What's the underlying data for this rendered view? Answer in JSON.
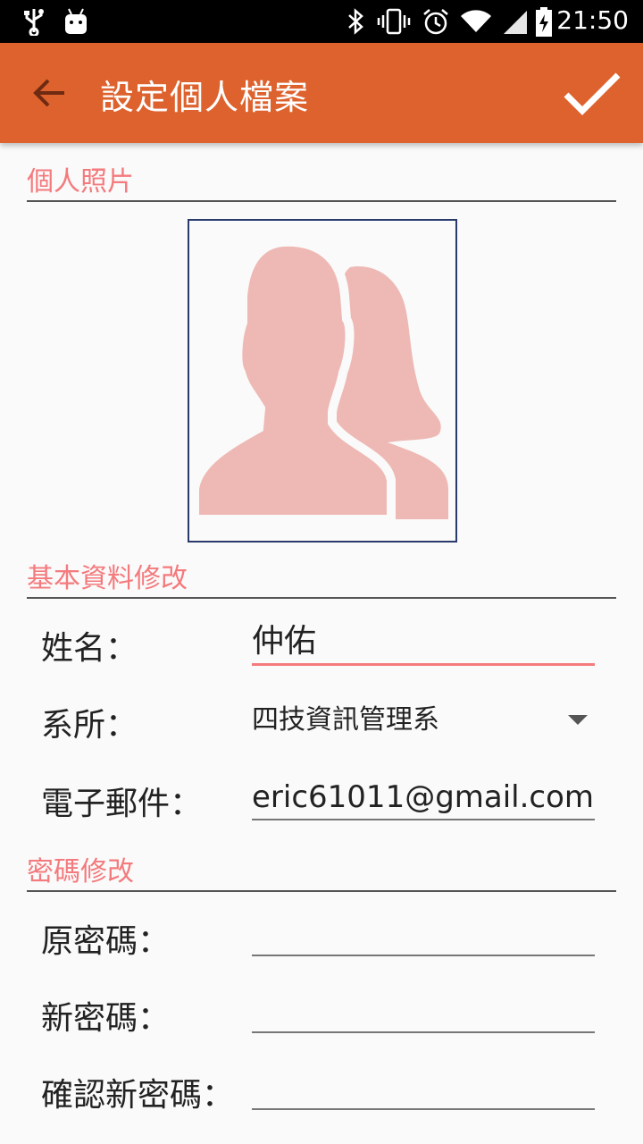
{
  "status_bar": {
    "time": "21:50",
    "icons": [
      "usb-icon",
      "android-icon",
      "bluetooth-icon",
      "vibrate-icon",
      "alarm-icon",
      "wifi-icon",
      "signal-icon",
      "battery-charging-icon"
    ]
  },
  "toolbar": {
    "title": "設定個人檔案",
    "back_icon": "arrow-back-icon",
    "confirm_icon": "check-icon"
  },
  "sections": {
    "photo": "個人照片",
    "basic": "基本資料修改",
    "password": "密碼修改"
  },
  "photo": {
    "icon": "person-silhouettes-icon",
    "silhouette_color": "#eeb9b5"
  },
  "form": {
    "name_label": "姓名：",
    "name_value": "仲佑",
    "dept_label": "系所：",
    "dept_value": "四技資訊管理系",
    "email_label": "電子郵件：",
    "email_value": "eric61011@gmail.com",
    "old_pw_label": "原密碼：",
    "new_pw_label": "新密碼：",
    "confirm_pw_label": "確認新密碼："
  },
  "colors": {
    "toolbar": "#dd622d",
    "accent": "#f47a7d",
    "background": "#fafafa"
  }
}
